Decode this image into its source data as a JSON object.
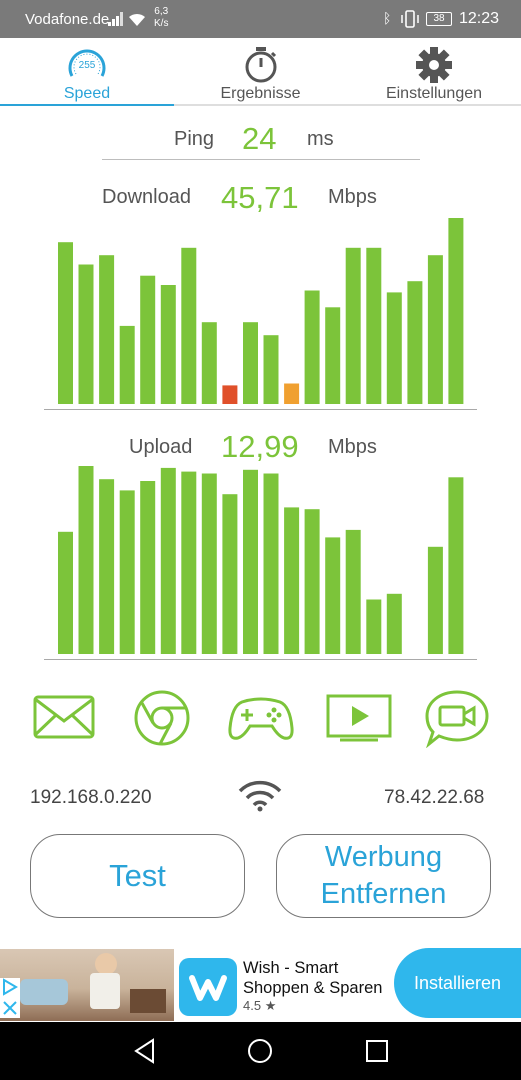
{
  "status_bar": {
    "carrier": "Vodafone.de",
    "net_speed_value": "6,3",
    "net_speed_unit": "K/s",
    "battery": "38",
    "time": "12:23"
  },
  "tabs": [
    {
      "label": "Speed",
      "icon": "speedometer-icon",
      "active": true,
      "gauge_text": "255"
    },
    {
      "label": "Ergebnisse",
      "icon": "stopwatch-icon",
      "active": false
    },
    {
      "label": "Einstellungen",
      "icon": "gear-icon",
      "active": false
    }
  ],
  "ping": {
    "label": "Ping",
    "value": "24",
    "unit": "ms"
  },
  "download": {
    "label": "Download",
    "value": "45,71",
    "unit": "Mbps"
  },
  "upload": {
    "label": "Upload",
    "value": "12,99",
    "unit": "Mbps"
  },
  "colors": {
    "accent_blue": "#2aa3d8",
    "bar_green": "#7cc43a",
    "bar_red": "#e0502a",
    "bar_orange": "#f0a030",
    "tab_inactive": "#555555"
  },
  "chart_data": [
    {
      "type": "bar",
      "name": "download",
      "ylim": [
        0,
        100
      ],
      "values": [
        87,
        75,
        80,
        42,
        69,
        64,
        84,
        44,
        10,
        44,
        37,
        11,
        61,
        52,
        84,
        84,
        60,
        66,
        80,
        100
      ],
      "bar_colors": [
        "green",
        "green",
        "green",
        "green",
        "green",
        "green",
        "green",
        "green",
        "red",
        "green",
        "green",
        "orange",
        "green",
        "green",
        "green",
        "green",
        "green",
        "green",
        "green",
        "green"
      ]
    },
    {
      "type": "bar",
      "name": "upload",
      "ylim": [
        0,
        100
      ],
      "values": [
        65,
        100,
        93,
        87,
        92,
        99,
        97,
        96,
        85,
        98,
        96,
        78,
        77,
        62,
        66,
        29,
        32,
        0,
        57,
        94
      ]
    }
  ],
  "categories": [
    {
      "icon": "email-envelope-icon"
    },
    {
      "icon": "chrome-browser-icon"
    },
    {
      "icon": "gamepad-icon"
    },
    {
      "icon": "video-play-icon"
    },
    {
      "icon": "video-chat-icon"
    }
  ],
  "network": {
    "local_ip": "192.168.0.220",
    "connection_icon": "wifi-icon",
    "public_ip": "78.42.22.68"
  },
  "buttons": {
    "test_label": "Test",
    "remove_ads_line1": "Werbung",
    "remove_ads_line2": "Entfernen"
  },
  "ad": {
    "title_line1": "Wish - Smart",
    "title_line2": "Shoppen & Sparen",
    "rating": "4.5",
    "rating_star": "★",
    "install_label": "Installieren"
  }
}
